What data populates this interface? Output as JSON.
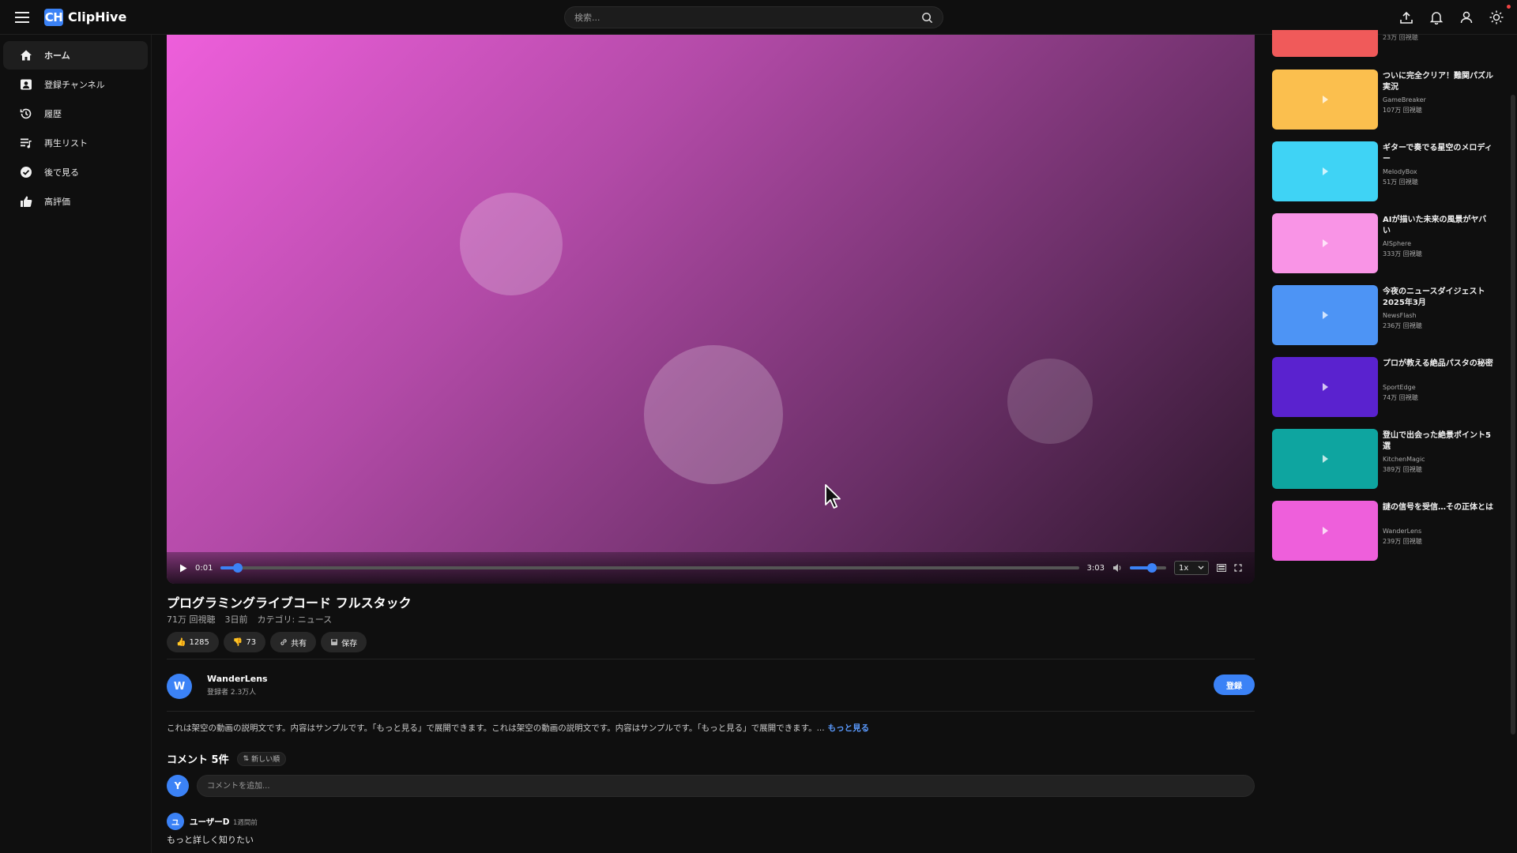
{
  "app": {
    "logo_badge": "CH",
    "name": "ClipHive"
  },
  "search": {
    "placeholder": "検索..."
  },
  "sidebar": {
    "items": [
      {
        "label": "ホーム",
        "icon": "home-icon",
        "active": true
      },
      {
        "label": "登録チャンネル",
        "icon": "subscriptions-icon"
      },
      {
        "label": "履歴",
        "icon": "history-icon"
      },
      {
        "label": "再生リスト",
        "icon": "playlist-icon"
      },
      {
        "label": "後で見る",
        "icon": "watch-later-icon"
      },
      {
        "label": "高評価",
        "icon": "thumbs-up-icon"
      }
    ]
  },
  "player": {
    "current_time": "0:01",
    "duration": "3:03",
    "progress": 0.0055,
    "volume": 0.6,
    "speed": "1x"
  },
  "video": {
    "title": "プログラミングライブコード フルスタック",
    "views": "71万 回視聴",
    "age": "3日前",
    "category": "カテゴリ: ニュース",
    "likes": "1285",
    "dislikes": "73",
    "share_label": "共有",
    "save_label": "保存"
  },
  "channel": {
    "avatar_letter": "W",
    "name": "WanderLens",
    "subscribers": "登録者 2.3万人",
    "subscribe_label": "登録"
  },
  "description": {
    "text": "これは架空の動画の説明文です。内容はサンプルです。「もっと見る」で展開できます。これは架空の動画の説明文です。内容はサンプルです。「もっと見る」で展開できます。...",
    "more_label": "もっと見る"
  },
  "comments": {
    "count_label": "コメント 5件",
    "sort_label": "新しい順",
    "my_avatar": "Y",
    "input_placeholder": "コメントを追加...",
    "items": [
      {
        "avatar": "ユ",
        "user": "ユーザーD",
        "time": "1週間前",
        "text": "もっと詳しく知りたい"
      }
    ]
  },
  "related": {
    "top_partial_views": "23万 回視聴",
    "top_partial_color": "#f05a5a",
    "items": [
      {
        "title": "ついに完全クリア！難関パズル実況",
        "channel": "GameBreaker",
        "views": "107万 回視聴",
        "color": "#fbbf4e"
      },
      {
        "title": "ギターで奏でる星空のメロディー",
        "channel": "MelodyBox",
        "views": "51万 回視聴",
        "color": "#3fd3f5"
      },
      {
        "title": "AIが描いた未来の風景がヤバい",
        "channel": "AISphere",
        "views": "333万 回視聴",
        "color": "#f994e6"
      },
      {
        "title": "今夜のニュースダイジェスト 2025年3月",
        "channel": "NewsFlash",
        "views": "236万 回視聴",
        "color": "#4d94f5"
      },
      {
        "title": "プロが教える絶品パスタの秘密",
        "channel": "SportEdge",
        "views": "74万 回視聴",
        "color": "#5a22cf"
      },
      {
        "title": "登山で出会った絶景ポイント5選",
        "channel": "KitchenMagic",
        "views": "389万 回視聴",
        "color": "#0ea5a0"
      },
      {
        "title": "謎の信号を受信…その正体とは",
        "channel": "WanderLens",
        "views": "239万 回視聴",
        "color": "#ee5fdb"
      }
    ]
  }
}
